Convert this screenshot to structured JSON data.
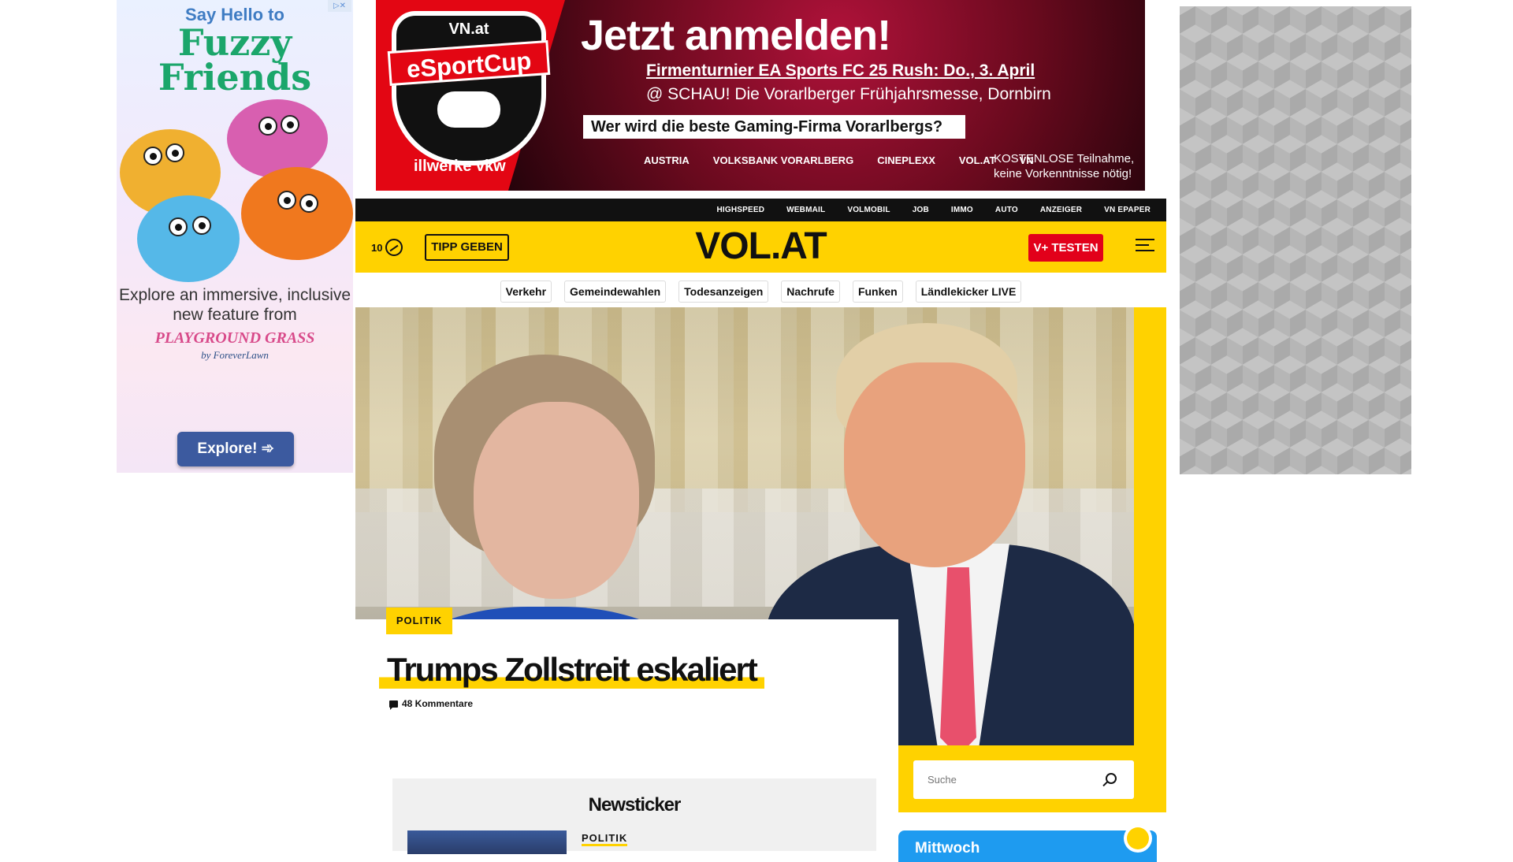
{
  "ad_left": {
    "adchoice": "▷✕",
    "say": "Say Hello to",
    "headline": "Fuzzy Friends",
    "body": "Explore an immersive, inclusive new feature from",
    "brand": "PLAYGROUND GRASS",
    "brand_sub": "by ForeverLawn",
    "button": "Explore! ➾"
  },
  "banner": {
    "vn": "VN.at",
    "cup": "eSportCup",
    "powered": "illwerke vkw",
    "headline": "Jetzt anmelden!",
    "line1": "Firmenturnier EA Sports FC 25 Rush: Do., 3. April",
    "line2": "@ SCHAU! Die Vorarlberger Frühjahrsmesse, Dornbirn",
    "question": "Wer wird die beste Gaming-Firma Vorarlbergs?",
    "sponsors": [
      "AUSTRIA",
      "VOLKSBANK VORARLBERG",
      "CINEPLEXX",
      "VOL.AT",
      "VN"
    ],
    "free1": "KOSTENLOSE Teilnahme,",
    "free2": "keine Vorkenntnisse nötig!"
  },
  "topbar": [
    "HIGHSPEED",
    "WEBMAIL",
    "VOLMOBIL",
    "JOB",
    "IMMO",
    "AUTO",
    "ANZEIGER",
    "VN EPAPER"
  ],
  "header": {
    "counter": "10",
    "tipp": "TIPP GEBEN",
    "logo": "VOL.AT",
    "vplus": "V+ TESTEN"
  },
  "categories": [
    "Verkehr",
    "Gemeindewahlen",
    "Todesanzeigen",
    "Nachrufe",
    "Funken",
    "Ländlekicker LIVE"
  ],
  "hero": {
    "category": "POLITIK",
    "headline": "Trumps Zollstreit eskaliert",
    "comments": "48 Kommentare"
  },
  "search": {
    "placeholder": "Suche"
  },
  "ticker": {
    "title": "Newsticker",
    "category": "POLITIK"
  },
  "weather": {
    "day": "Mittwoch"
  },
  "colors": {
    "accent": "#ffd200",
    "red": "#e2001a",
    "black": "#111111"
  }
}
